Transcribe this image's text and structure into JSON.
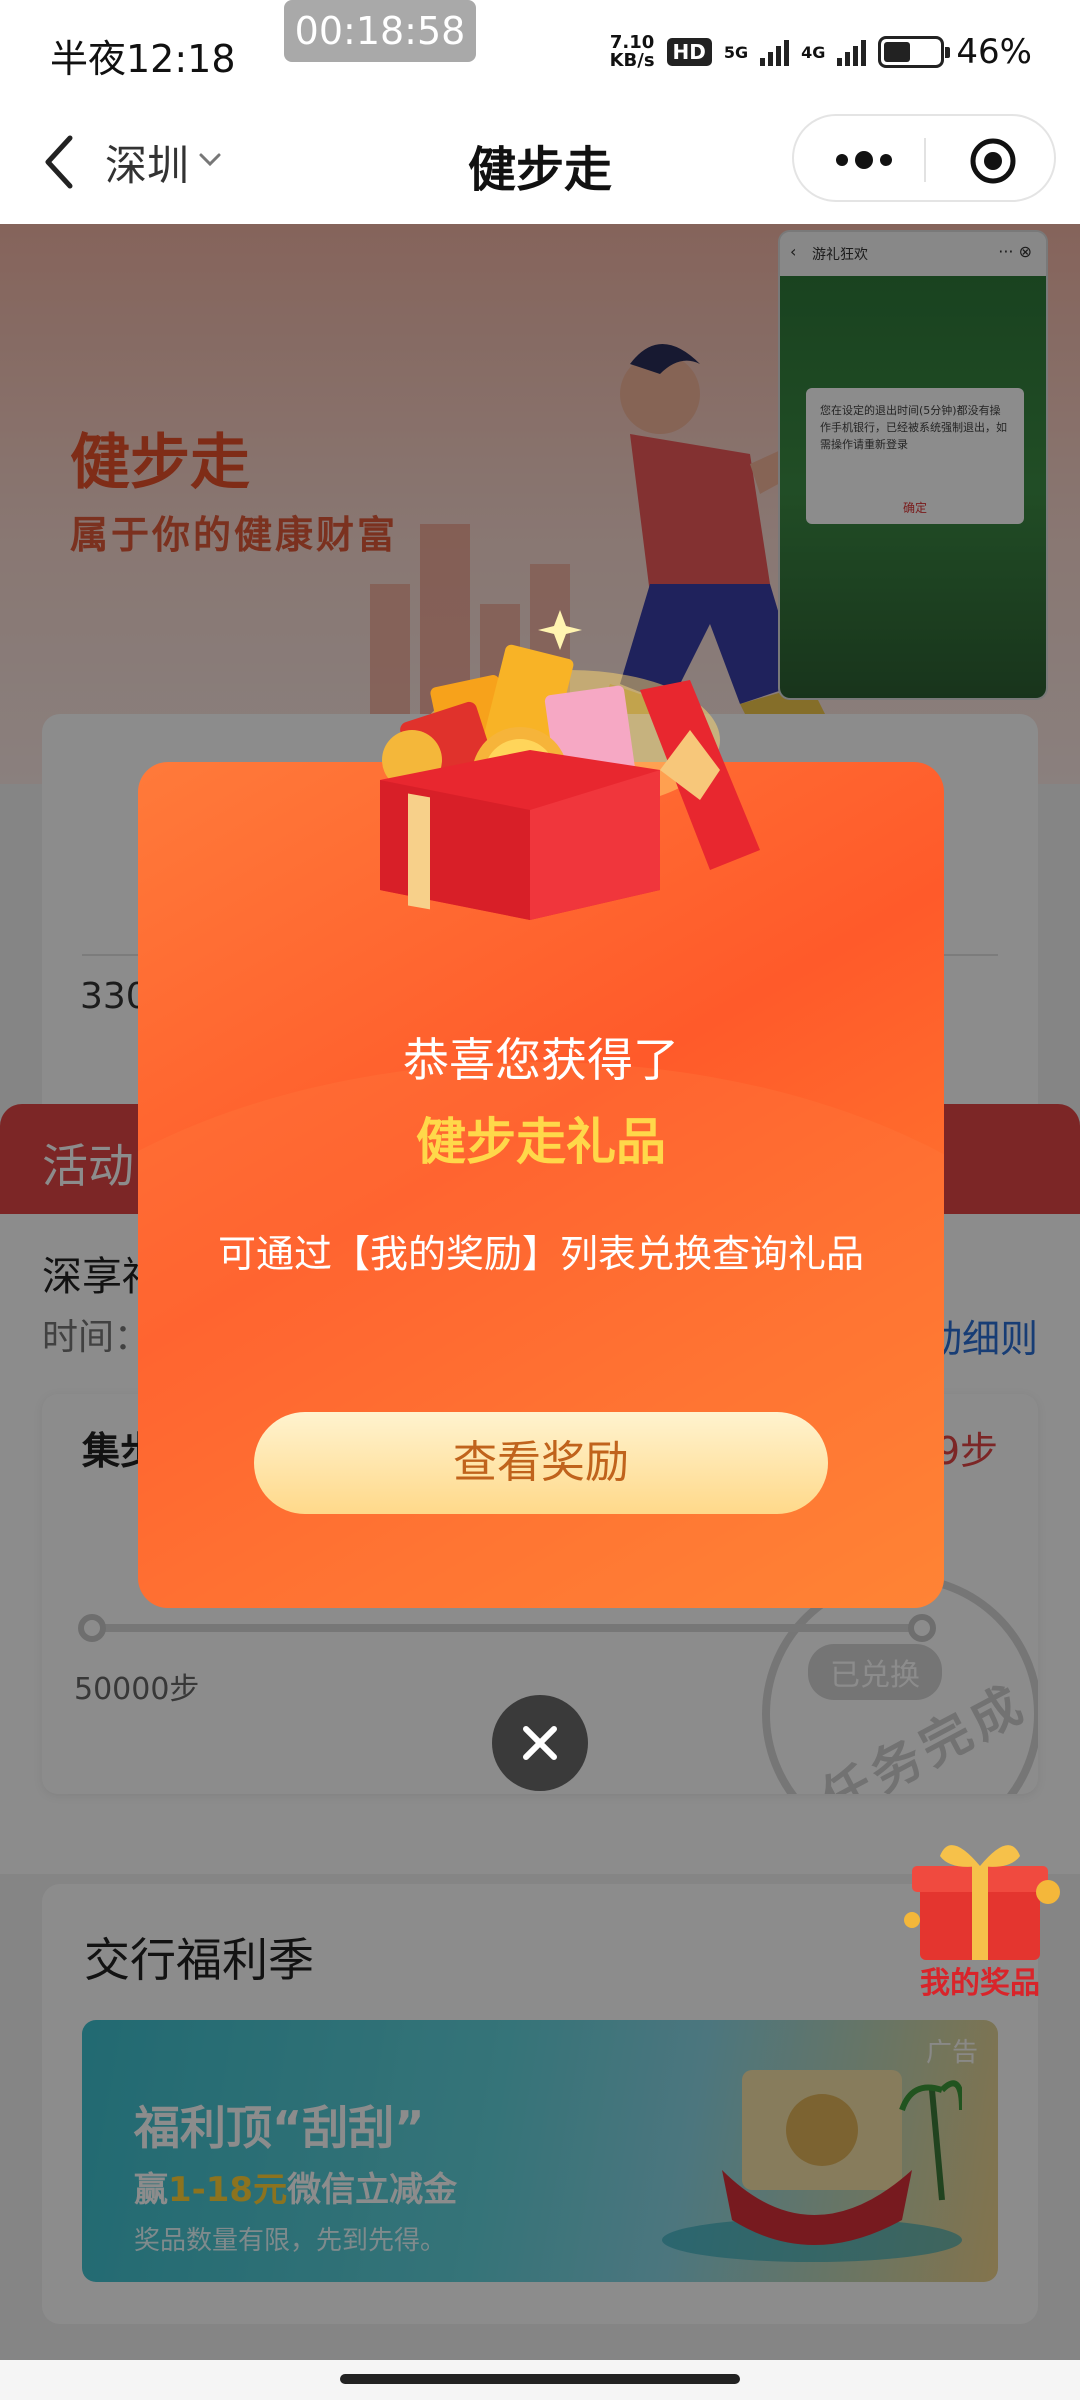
{
  "status_bar": {
    "time": "半夜12:18",
    "recording_timer": "00:18:58",
    "net_speed_value": "7.10",
    "net_speed_unit": "KB/s",
    "hd_badge": "HD",
    "net_5g": "5G",
    "net_4g": "4G",
    "battery_percent": "46%"
  },
  "nav": {
    "city": "深圳",
    "title": "健步走"
  },
  "hero": {
    "title": "健步走",
    "subtitle": "属于你的健康财富"
  },
  "step_card": {
    "steps_partial": "330"
  },
  "activity": {
    "header_title": "活动",
    "name_partial": "深享福",
    "time_label": "时间：",
    "rules_link": "动细则",
    "mission_title": "集步",
    "mission_steps_partial": "9步",
    "start_label": "50000步",
    "redeemed_badge": "已兑换",
    "stamp_text": "任务完成"
  },
  "welfare": {
    "title": "交行福利季",
    "ad_tag": "广告",
    "banner_headline": "福利顶“刮刮”",
    "banner_line_prefix": "赢",
    "banner_line_highlight": "1-18元",
    "banner_line_suffix": "微信立减金",
    "banner_note": "奖品数量有限，先到先得。"
  },
  "gift_widget": {
    "label": "我的奖品"
  },
  "pip": {
    "title": "游礼狂欢",
    "controls": "··· ⊗",
    "dialog_text": "您在设定的退出时间(5分钟)都没有操作手机银行，已经被系统强制退出，如需操作请重新登录",
    "dialog_button": "确定"
  },
  "modal": {
    "congrats": "恭喜您获得了",
    "prize_name": "健步走礼品",
    "description": "可通过【我的奖励】列表兑换查询礼品",
    "view_button": "查看奖励"
  },
  "colors": {
    "accent_red": "#e24545",
    "modal_orange": "#ff6a30",
    "prize_gold": "#ffd84a",
    "link_blue": "#2b6fd6"
  }
}
